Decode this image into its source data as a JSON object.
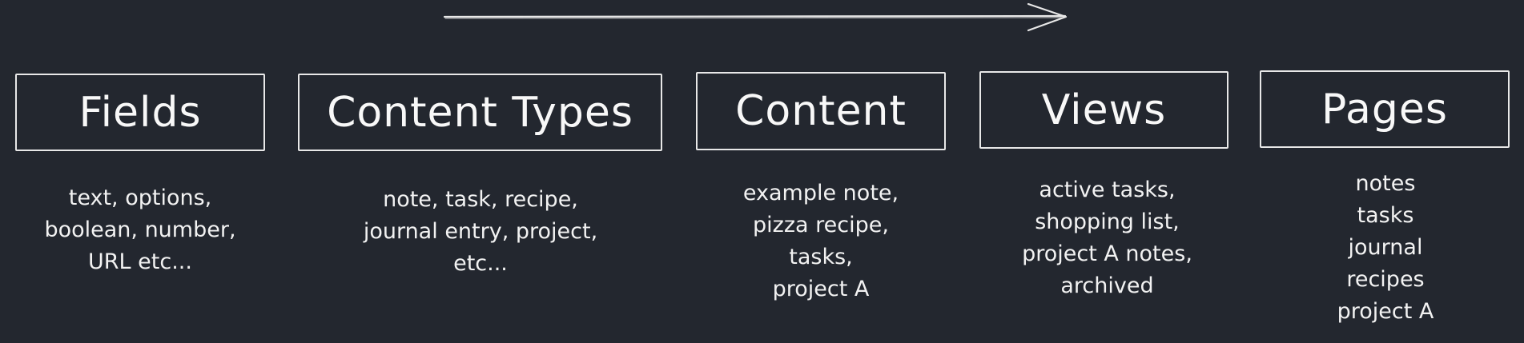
{
  "diagram": {
    "stages": [
      {
        "title": "Fields",
        "lines": [
          "text, options,",
          "boolean, number,",
          "URL etc..."
        ]
      },
      {
        "title": "Content Types",
        "lines": [
          "note, task, recipe,",
          "journal entry, project,",
          "etc..."
        ]
      },
      {
        "title": "Content",
        "lines": [
          "example note,",
          "pizza recipe,",
          "tasks,",
          "project A"
        ]
      },
      {
        "title": "Views",
        "lines": [
          "active tasks,",
          "shopping list,",
          "project A notes,",
          "archived"
        ]
      },
      {
        "title": "Pages",
        "lines": [
          "notes",
          "tasks",
          "journal",
          "recipes",
          "project A"
        ]
      }
    ]
  },
  "colors": {
    "background": "#23272f",
    "stroke": "#e8e8e8",
    "text": "#f4f4f4"
  }
}
